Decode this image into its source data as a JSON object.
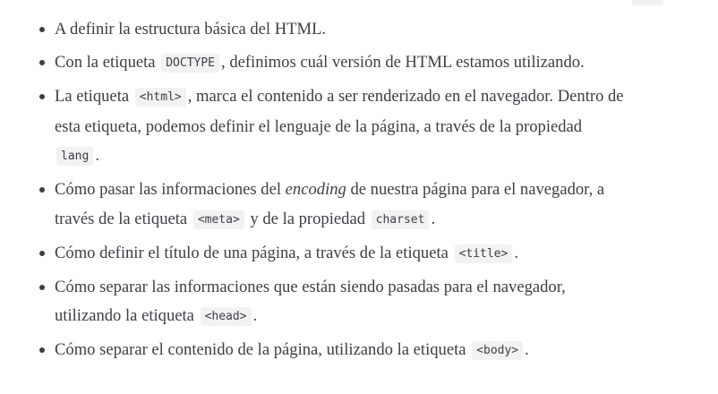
{
  "items": [
    {
      "segments": [
        {
          "type": "text",
          "value": "A definir la estructura básica del HTML."
        }
      ]
    },
    {
      "segments": [
        {
          "type": "text",
          "value": "Con la etiqueta "
        },
        {
          "type": "code",
          "value": "DOCTYPE"
        },
        {
          "type": "text",
          "value": ", definimos cuál versión de HTML estamos utilizando."
        }
      ]
    },
    {
      "segments": [
        {
          "type": "text",
          "value": "La etiqueta "
        },
        {
          "type": "code",
          "value": "<html>"
        },
        {
          "type": "text",
          "value": ", marca el contenido a ser renderizado en el navegador. Dentro de esta etiqueta, podemos definir el lenguaje de la página, a través de la propiedad "
        },
        {
          "type": "code",
          "value": "lang"
        },
        {
          "type": "text",
          "value": "."
        }
      ]
    },
    {
      "segments": [
        {
          "type": "text",
          "value": "Cómo pasar las informaciones del "
        },
        {
          "type": "em",
          "value": "encoding"
        },
        {
          "type": "text",
          "value": " de nuestra página para el navegador, a través de la etiqueta "
        },
        {
          "type": "code",
          "value": "<meta>"
        },
        {
          "type": "text",
          "value": " y de la propiedad "
        },
        {
          "type": "code",
          "value": "charset"
        },
        {
          "type": "text",
          "value": "."
        }
      ]
    },
    {
      "segments": [
        {
          "type": "text",
          "value": "Cómo definir el título de una página, a través de la etiqueta "
        },
        {
          "type": "code",
          "value": "<title>"
        },
        {
          "type": "text",
          "value": "."
        }
      ]
    },
    {
      "segments": [
        {
          "type": "text",
          "value": "Cómo separar las informaciones que están siendo pasadas para el navegador, utilizando la etiqueta "
        },
        {
          "type": "code",
          "value": "<head>"
        },
        {
          "type": "text",
          "value": "."
        }
      ]
    },
    {
      "segments": [
        {
          "type": "text",
          "value": "Cómo separar el contenido de la página, utilizando la etiqueta "
        },
        {
          "type": "code",
          "value": "<body>"
        },
        {
          "type": "text",
          "value": "."
        }
      ]
    }
  ]
}
